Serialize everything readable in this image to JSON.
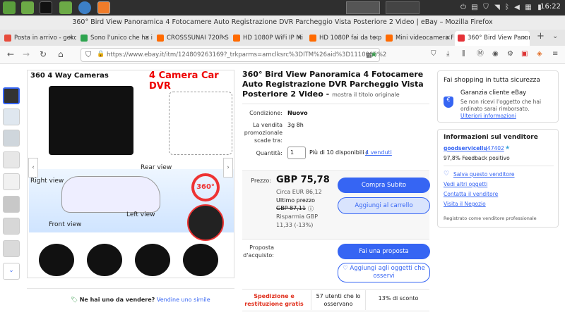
{
  "desktop": {
    "clock": "16:22"
  },
  "window": {
    "title": "360° Bird View Panoramica 4 Fotocamere Auto Registrazione DVR Parcheggio Vista Posteriore 2 Video | eBay – Mozilla Firefox"
  },
  "tabs": [
    {
      "label": "Posta in arrivo - geko",
      "color": "#e74c3c"
    },
    {
      "label": "Sono l'unico che ha il",
      "color": "#2ea44f"
    },
    {
      "label": "CROSSSUNAI 720P S",
      "color": "#ff6a00"
    },
    {
      "label": "HD 1080P WiFi IP Mi",
      "color": "#ff6a00"
    },
    {
      "label": "HD 1080P fai da te p",
      "color": "#ff6a00"
    },
    {
      "label": "Mini videocamera Fu",
      "color": "#ff6a00"
    },
    {
      "label": "360° Bird View Panor",
      "color": "#e53238"
    }
  ],
  "url": "https://www.ebay.it/itm/124809263169?_trkparms=amclksrc%3DITM%26aid%3D1110006%2",
  "product": {
    "title": "360° Bird View Panoramica 4 Fotocamere Auto Registrazione DVR Parcheggio Vista Posteriore 2 Video -",
    "show_original": "mostra il titolo originale",
    "condition_label": "Condizione:",
    "condition_value": "Nuovo",
    "promo_label": "La vendita promozionale scade tra:",
    "promo_value": "3g 8h",
    "qty_label": "Quantità:",
    "qty_value": "1",
    "qty_info": "Più di 10 disponibili /",
    "sold": "4 venduti",
    "price_label": "Prezzo:",
    "price": "GBP 75,78",
    "approx": "Circa EUR 86,12",
    "last_price_label": "Ultimo prezzo",
    "last_price": "GBP 87,11",
    "saving_label": "Risparmia GBP",
    "saving_value": "11,33 (-13%)",
    "buy_now": "Compra Subito",
    "add_cart": "Aggiungi al carrello",
    "offer_label": "Proposta d'acquisto:",
    "make_offer": "Fai una proposta",
    "watch": "Aggiungi agli oggetti che osservi",
    "shipping_title": "Spedizione e restituzione gratis",
    "watchers": "57 utenti che lo osservano",
    "discount": "13% di sconto",
    "sell_prompt": "Ne hai uno da vendere?",
    "sell_link": "Vendine uno simile"
  },
  "image_text": {
    "banner_left": "360 4 Way Cameras",
    "banner_right": "4 Camera Car DVR",
    "right_view": "Right view",
    "rear_view": "Rear view",
    "left_view": "Left view",
    "front_view": "Front view",
    "badge": "360°"
  },
  "sidebar": {
    "safe_title": "Fai shopping in tutta sicurezza",
    "guarantee_title": "Garanzia cliente eBay",
    "guarantee_text": "Se non ricevi l'oggetto che hai ordinato sarai rimborsato.",
    "more_info": "Ulteriori informazioni",
    "seller_title": "Informazioni sul venditore",
    "seller_name": "goodservicellu",
    "seller_score": "(47402",
    "feedback": "97,8% Feedback positivo",
    "save_seller": "Salva questo venditore",
    "other_items": "Vedi altri oggetti",
    "contact": "Contatta il venditore",
    "store": "Visita il Negozio",
    "registered": "Registrato come venditore professionale"
  }
}
